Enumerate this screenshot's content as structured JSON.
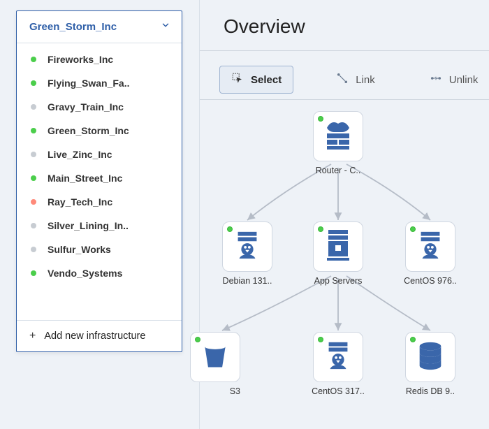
{
  "sidebar": {
    "selected": "Green_Storm_Inc",
    "items": [
      {
        "label": "Fireworks_Inc",
        "status": "green"
      },
      {
        "label": "Flying_Swan_Fa..",
        "status": "green"
      },
      {
        "label": "Gravy_Train_Inc",
        "status": "grey"
      },
      {
        "label": "Green_Storm_Inc",
        "status": "green"
      },
      {
        "label": "Live_Zinc_Inc",
        "status": "grey"
      },
      {
        "label": "Main_Street_Inc",
        "status": "green"
      },
      {
        "label": "Ray_Tech_Inc",
        "status": "red"
      },
      {
        "label": "Silver_Lining_In..",
        "status": "grey"
      },
      {
        "label": "Sulfur_Works",
        "status": "grey"
      },
      {
        "label": "Vendo_Systems",
        "status": "green"
      }
    ],
    "add_label": "Add new infrastructure"
  },
  "main": {
    "title": "Overview",
    "toolbar": {
      "select": "Select",
      "link": "Link",
      "unlink": "Unlink"
    }
  },
  "nodes": {
    "router": "Router - C..",
    "debian": "Debian 131..",
    "appsrv": "App Servers",
    "centos976": "CentOS 976..",
    "s3": "S3",
    "centos317": "CentOS 317..",
    "redis": "Redis DB 9.."
  }
}
